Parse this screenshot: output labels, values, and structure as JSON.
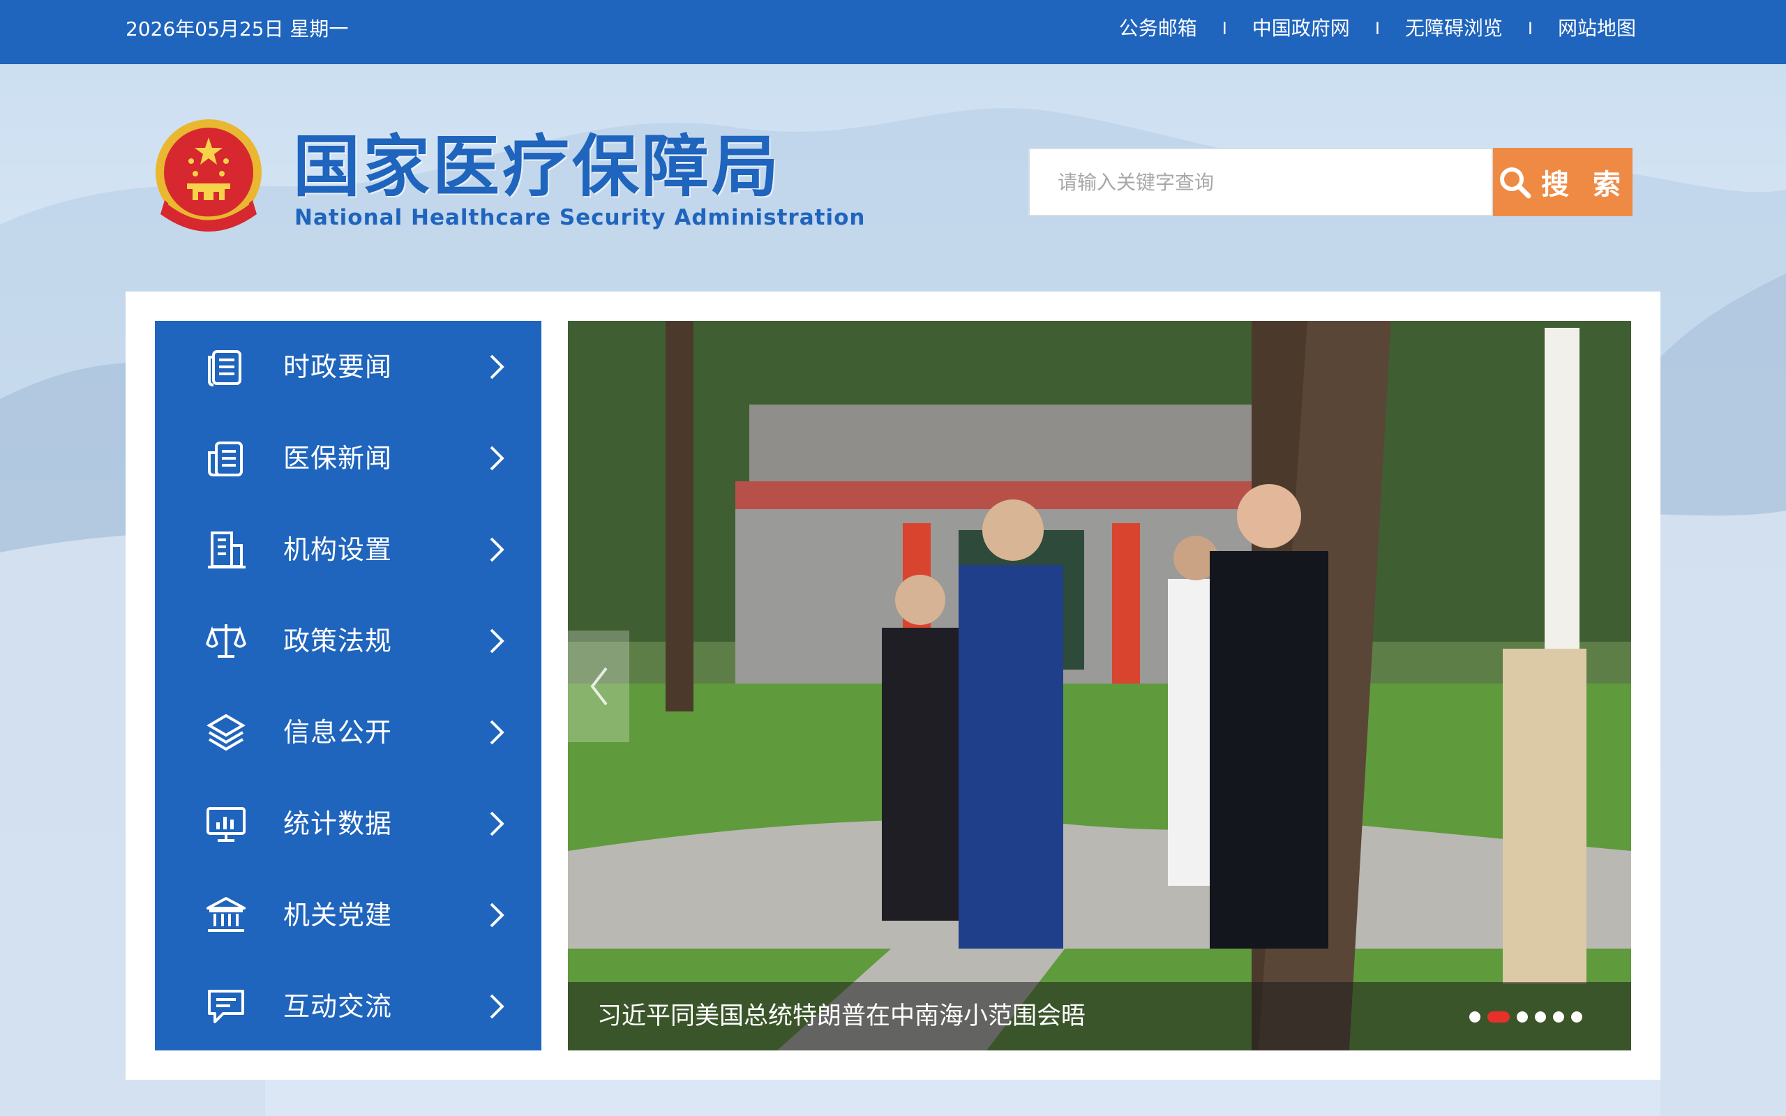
{
  "topbar": {
    "date": "2026年05月25日 星期一",
    "links": [
      {
        "label": "公务邮箱"
      },
      {
        "label": "中国政府网"
      },
      {
        "label": "无障碍浏览"
      },
      {
        "label": "网站地图"
      }
    ],
    "separator": "I"
  },
  "header": {
    "title": "国家医疗保障局",
    "subtitle": "National Healthcare Security Administration",
    "search": {
      "placeholder": "请输入关键字查询",
      "value": "",
      "button_label": "搜 索"
    }
  },
  "nav": {
    "items": [
      {
        "label": "时政要闻",
        "icon": "document-icon"
      },
      {
        "label": "医保新闻",
        "icon": "newspaper-icon"
      },
      {
        "label": "机构设置",
        "icon": "building-icon"
      },
      {
        "label": "政策法规",
        "icon": "scales-icon"
      },
      {
        "label": "信息公开",
        "icon": "layers-icon"
      },
      {
        "label": "统计数据",
        "icon": "chart-monitor-icon"
      },
      {
        "label": "机关党建",
        "icon": "institution-icon"
      },
      {
        "label": "互动交流",
        "icon": "chat-icon"
      }
    ]
  },
  "carousel": {
    "caption": "习近平同美国总统特朗普在中南海小范围会晤",
    "slide_count": 6,
    "active_index": 1
  },
  "colors": {
    "brand_blue": "#1f64bd",
    "search_orange": "#ef8a45",
    "active_dot_red": "#e8302b"
  }
}
